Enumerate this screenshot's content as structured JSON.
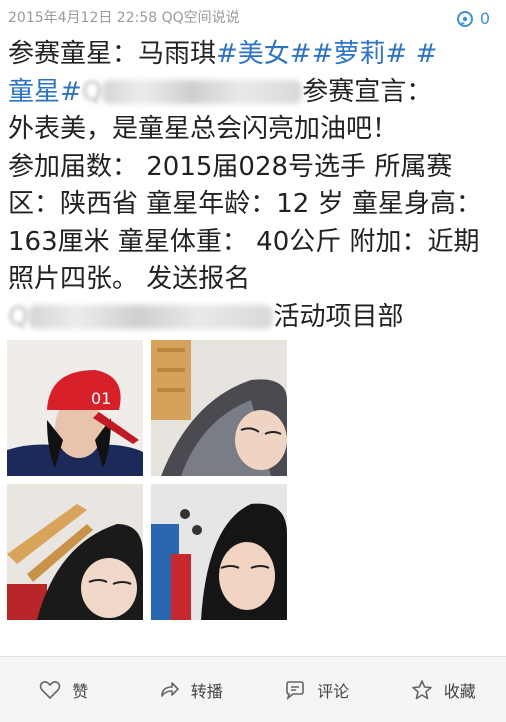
{
  "header": {
    "meta": "2015年4月12日 22:58 QQ空间说说",
    "comment_count": "0"
  },
  "post": {
    "line1": "参赛童星：马雨琪",
    "tag1": "#美女#",
    "tag2": "#萝莉#",
    "tag3a": "#",
    "tag3b": "童星#",
    "lead_char": "Q",
    "after_blur1": "参赛宣言：",
    "text2": "外表美，是童星总会闪亮加油吧！",
    "text3": "参加届数： 2015届028号选手 所属赛区：陕西省 童星年龄：12 岁 童星身高： 163厘米 童星体重： 40公斤 附加：近期照片四张。 发送报名",
    "lead_char2": "Q",
    "after_blur2": "活动项目部"
  },
  "photos": [
    {
      "alt": "selfie with red cap"
    },
    {
      "alt": "selfie with long hair"
    },
    {
      "alt": "selfie in room"
    },
    {
      "alt": "selfie close-up"
    }
  ],
  "actions": {
    "like": "赞",
    "share": "转播",
    "comment": "评论",
    "favorite": "收藏"
  }
}
